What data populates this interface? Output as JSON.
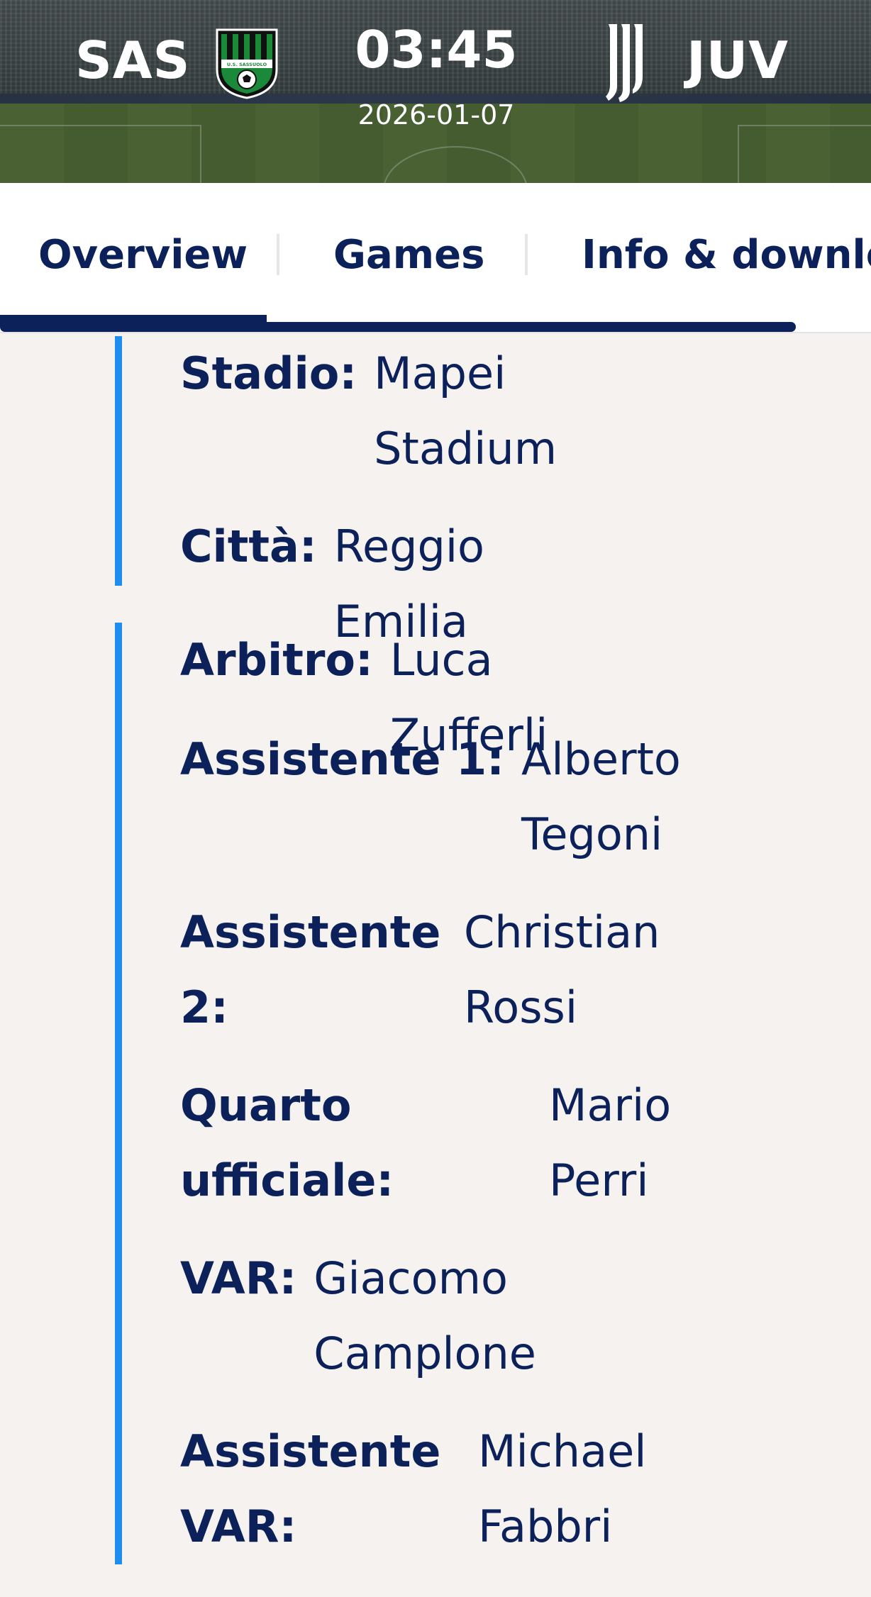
{
  "match": {
    "home_code": "SAS",
    "away_code": "JUV",
    "time": "03:45",
    "date": "2026-01-07",
    "home_crest_text": "U.S. SASSUOLO"
  },
  "colors": {
    "brand_navy": "#0c2159",
    "accent_blue": "#1d8ef0",
    "crest_green": "#1a8a3a",
    "page_bg": "#f5f2ef"
  },
  "tabs": [
    {
      "label": "Overview",
      "active": true
    },
    {
      "label": "Games",
      "active": false
    },
    {
      "label": "Info & downloa",
      "active": false
    }
  ],
  "venue": {
    "stadium_label": "Stadio:",
    "stadium_value": "Mapei Stadium",
    "city_label": "Città:",
    "city_value": "Reggio Emilia"
  },
  "officials": {
    "referee_label": "Arbitro:",
    "referee_value": "Luca Zufferli",
    "assistant1_label": "Assistente 1:",
    "assistant1_value": "Alberto Tegoni",
    "assistant2_label": "Assistente 2:",
    "assistant2_value": "Christian Rossi",
    "fourth_label": "Quarto ufficiale:",
    "fourth_value": "Mario Perri",
    "var_label": "VAR:",
    "var_value": "Giacomo Camplone",
    "avar_label": "Assistente VAR:",
    "avar_value": "Michael Fabbri"
  },
  "icons": {
    "home_crest": "sassuolo-crest-icon",
    "away_logo": "juventus-logo-icon"
  }
}
